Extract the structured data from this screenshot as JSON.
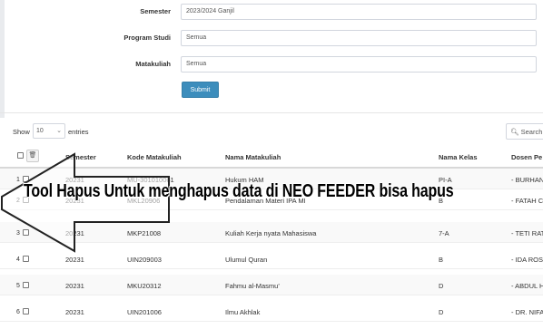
{
  "filters": {
    "semester": {
      "label": "Semester",
      "value": "2023/2024 Ganjil"
    },
    "program_studi": {
      "label": "Program Studi",
      "value": "Semua"
    },
    "matakuliah": {
      "label": "Matakuliah",
      "value": "Semua"
    },
    "submit_label": "Submit"
  },
  "table_controls": {
    "show_label": "Show",
    "page_size": "10",
    "entries_label": "entries",
    "search_label": "Search"
  },
  "table": {
    "columns": [
      "Semester",
      "Kode Matakuliah",
      "Nama Matakuliah",
      "Nama Kelas",
      "Dosen Pe"
    ],
    "rows": [
      {
        "no": "1",
        "semester": "20231",
        "kode": "MU-301010061",
        "nama": "Hukum HAM",
        "kelas": "PI-A",
        "dosen": "- BURHAN"
      },
      {
        "no": "2",
        "semester": "20231",
        "kode": "MKL20906",
        "nama": "Pendalaman Materi IPA MI",
        "kelas": "B",
        "dosen": "- FATAH C"
      },
      {
        "no": "3",
        "semester": "20231",
        "kode": "MKP21008",
        "nama": "Kuliah Kerja nyata Mahasiswa",
        "kelas": "7-A",
        "dosen": "- TETI RAT"
      },
      {
        "no": "4",
        "semester": "20231",
        "kode": "UIN209003",
        "nama": "Ulumul Quran",
        "kelas": "B",
        "dosen": "- IDA ROSY"
      },
      {
        "no": "5",
        "semester": "20231",
        "kode": "MKU20312",
        "nama": "Fahmu al-Masmu'",
        "kelas": "D",
        "dosen": "- ABDUL H"
      },
      {
        "no": "6",
        "semester": "20231",
        "kode": "UIN201006",
        "nama": "Ilmu Akhlak",
        "kelas": "D",
        "dosen": "- DR. NIFA"
      }
    ]
  },
  "overlay": {
    "caption": "Tool Hapus Untuk menghapus data di NEO FEEDER bisa hapus"
  },
  "icons": {
    "trash": "trash-icon",
    "chevron": "chevron-down-icon",
    "search": "search-icon",
    "arrow": "arrow-left-icon"
  },
  "colors": {
    "primary": "#3c8dbc",
    "border": "#d2d6de",
    "row_alt": "#f9f9f9"
  }
}
